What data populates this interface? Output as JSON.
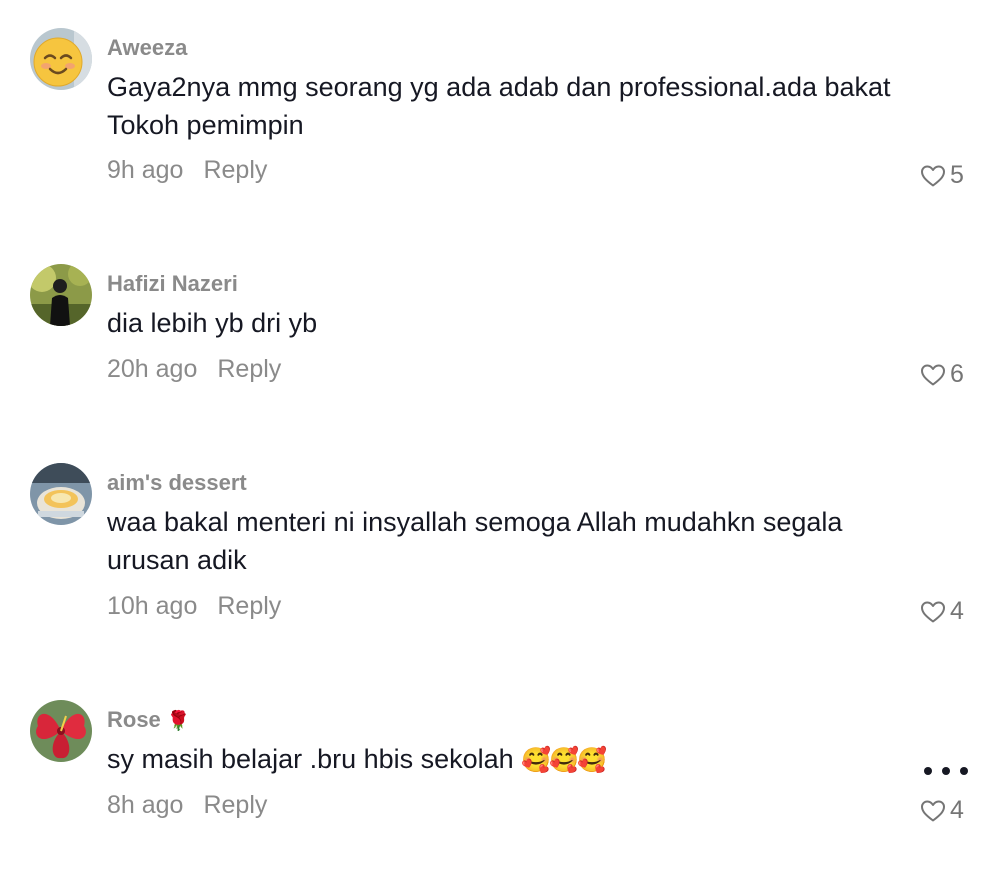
{
  "comments": [
    {
      "username": "Aweeza",
      "text": "Gaya2nya mmg seorang yg ada adab dan professional.ada bakat Tokoh pemimpin",
      "time": "9h ago",
      "reply_label": "Reply",
      "likes": "5",
      "avatar_icon": "smiling-face-avatar"
    },
    {
      "username": "Hafizi Nazeri",
      "text": "dia lebih yb dri yb",
      "time": "20h ago",
      "reply_label": "Reply",
      "likes": "6",
      "avatar_icon": "person-photo-avatar"
    },
    {
      "username": "aim's dessert",
      "text": "waa bakal menteri ni insyallah semoga Allah mudahkn segala urusan adik",
      "time": "10h ago",
      "reply_label": "Reply",
      "likes": "4",
      "avatar_icon": "dessert-photo-avatar"
    },
    {
      "username": "Rose",
      "username_emoji": "🌹",
      "text": "sy masih belajar .bru hbis sekolah ",
      "text_emoji": "🥰🥰🥰",
      "time": "8h ago",
      "reply_label": "Reply",
      "likes": "4",
      "avatar_icon": "hibiscus-flower-avatar"
    }
  ],
  "colors": {
    "text": "#161823",
    "secondary": "#8a8a8a",
    "background": "#ffffff"
  }
}
